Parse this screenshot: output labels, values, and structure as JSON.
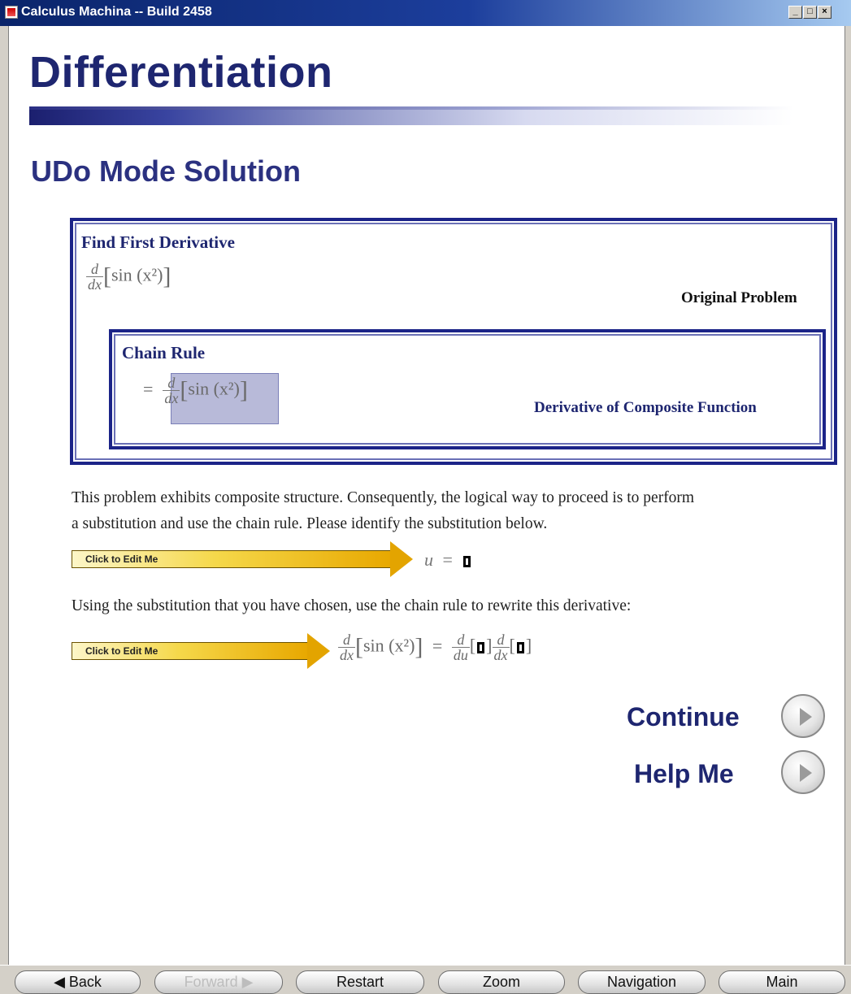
{
  "window": {
    "title": "Calculus Machina -- Build 2458",
    "buttons": [
      "_",
      "□",
      "×"
    ]
  },
  "header": {
    "title": "Differentiation",
    "subtitle": "UDo Mode Solution"
  },
  "problem": {
    "outer_title": "Find First Derivative",
    "outer_note": "Original Problem",
    "inner_title": "Chain Rule",
    "inner_note": "Derivative of Composite Function",
    "d_num": "d",
    "dx_den": "dx",
    "du_den": "du",
    "func": "sin (x²)",
    "equals": "="
  },
  "instructions": {
    "para1_line1": "This problem exhibits composite structure.  Consequently, the logical way to proceed is to perform",
    "para1_line2": "a substitution and use the chain rule.  Please identify the substitution below.",
    "para2": "Using the substitution that you have chosen, use the chain rule to rewrite this derivative:"
  },
  "edit": {
    "label1": "Click to Edit Me",
    "label2": "Click to Edit Me",
    "u_var": "u",
    "equals": "="
  },
  "actions": {
    "continue": "Continue",
    "help": "Help Me"
  },
  "nav": {
    "back": "◀ Back",
    "forward": "Forward ▶",
    "restart": "Restart",
    "zoom": "Zoom",
    "navigation": "Navigation",
    "main": "Main"
  }
}
